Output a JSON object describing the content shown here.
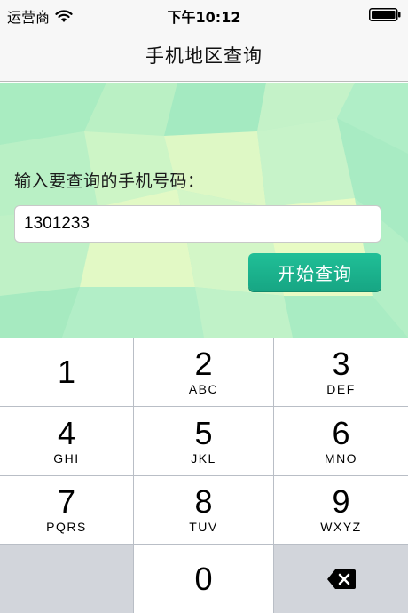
{
  "status_bar": {
    "carrier": "运营商",
    "time": "下午10:12",
    "wifi_icon": "wifi-icon",
    "battery_icon": "battery-icon"
  },
  "nav": {
    "title": "手机地区查询"
  },
  "form": {
    "prompt": "输入要查询的手机号码：",
    "phone_value": "1301233",
    "button_label": "开始查询",
    "accent_color": "#1db590"
  },
  "keypad": {
    "keys": [
      {
        "digit": "1",
        "letters": ""
      },
      {
        "digit": "2",
        "letters": "ABC"
      },
      {
        "digit": "3",
        "letters": "DEF"
      },
      {
        "digit": "4",
        "letters": "GHI"
      },
      {
        "digit": "5",
        "letters": "JKL"
      },
      {
        "digit": "6",
        "letters": "MNO"
      },
      {
        "digit": "7",
        "letters": "PQRS"
      },
      {
        "digit": "8",
        "letters": "TUV"
      },
      {
        "digit": "9",
        "letters": "WXYZ"
      },
      {
        "digit": "0",
        "letters": ""
      }
    ],
    "delete_icon": "backspace-icon"
  }
}
